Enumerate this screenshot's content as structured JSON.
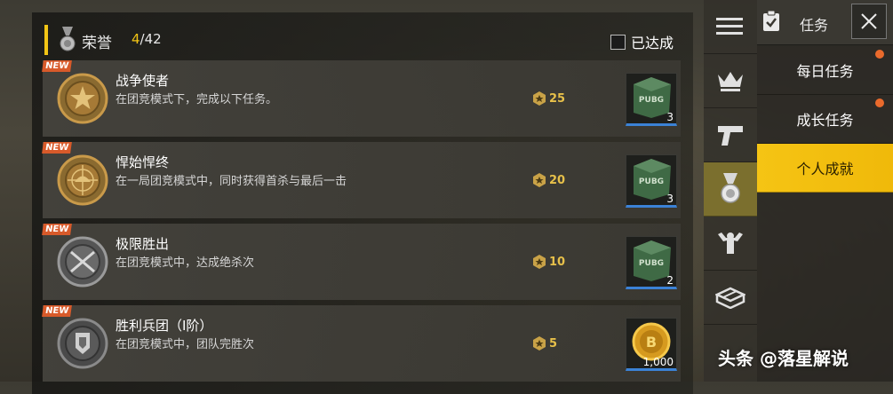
{
  "header": {
    "title": "荣誉",
    "count_current": "4",
    "count_total": "/42",
    "filter_label": "已达成"
  },
  "achievements": [
    {
      "new_tag": "NEW",
      "title": "战争使者",
      "desc": "在团竞模式下，完成以下任务。",
      "points": "25",
      "reward_qty": "3",
      "reward_type": "pubg-crate"
    },
    {
      "new_tag": "NEW",
      "title": "悍始悍终",
      "desc": "在一局团竞模式中，同时获得首杀与最后一击",
      "points": "20",
      "reward_qty": "3",
      "reward_type": "pubg-crate"
    },
    {
      "new_tag": "NEW",
      "title": "极限胜出",
      "desc": "在团竞模式中，达成绝杀次",
      "points": "10",
      "reward_qty": "2",
      "reward_type": "pubg-crate"
    },
    {
      "new_tag": "NEW",
      "title": "胜利兵团（I阶）",
      "desc": "在团竞模式中，团队完胜次",
      "points": "5",
      "reward_qty": "1,000",
      "reward_type": "bp-coin"
    }
  ],
  "tabs": [
    "menu-icon",
    "crown-icon",
    "pistol-icon",
    "medal-icon",
    "muscle-icon",
    "box-icon"
  ],
  "right_panel": {
    "title": "任务",
    "items": [
      {
        "label": "每日任务"
      },
      {
        "label": "成长任务"
      },
      {
        "label": "个人成就"
      }
    ]
  },
  "watermark": "头条 @落星解说",
  "colors": {
    "accent": "#f2c515",
    "new_tag": "#d85a2a",
    "points": "#e7c04a",
    "notify_dot": "#ea6a2c"
  }
}
